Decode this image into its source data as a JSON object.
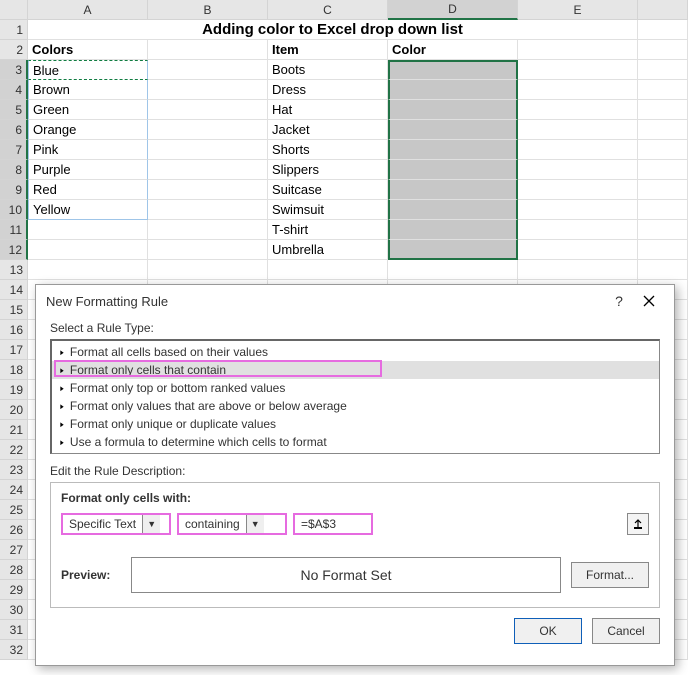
{
  "columns": [
    "A",
    "B",
    "C",
    "D",
    "E"
  ],
  "rows_shown": 32,
  "title": "Adding color to Excel drop down list",
  "headers": {
    "a": "Colors",
    "c": "Item",
    "d": "Color"
  },
  "colA": [
    "Blue",
    "Brown",
    "Green",
    "Orange",
    "Pink",
    "Purple",
    "Red",
    "Yellow"
  ],
  "colC": [
    "Boots",
    "Dress",
    "Hat",
    "Jacket",
    "Shorts",
    "Slippers",
    "Suitcase",
    "Swimsuit",
    "T-shirt",
    "Umbrella"
  ],
  "dialog": {
    "title": "New Formatting Rule",
    "select_label": "Select a Rule Type:",
    "rules": [
      "Format all cells based on their values",
      "Format only cells that contain",
      "Format only top or bottom ranked values",
      "Format only values that are above or below average",
      "Format only unique or duplicate values",
      "Use a formula to determine which cells to format"
    ],
    "selected_rule_index": 1,
    "edit_label": "Edit the Rule Description:",
    "format_with": "Format only cells with:",
    "combo1": "Specific Text",
    "combo2": "containing",
    "formula": "=$A$3",
    "preview_label": "Preview:",
    "preview_text": "No Format Set",
    "format_btn": "Format...",
    "ok": "OK",
    "cancel": "Cancel"
  },
  "chart_data": {
    "type": "table",
    "columns": [
      "Colors",
      "Item",
      "Color"
    ],
    "rows": [
      [
        "Blue",
        "Boots",
        ""
      ],
      [
        "Brown",
        "Dress",
        ""
      ],
      [
        "Green",
        "Hat",
        ""
      ],
      [
        "Orange",
        "Jacket",
        ""
      ],
      [
        "Pink",
        "Shorts",
        ""
      ],
      [
        "Purple",
        "Slippers",
        ""
      ],
      [
        "Red",
        "Suitcase",
        ""
      ],
      [
        "Yellow",
        "Swimsuit",
        ""
      ],
      [
        "",
        "T-shirt",
        ""
      ],
      [
        "",
        "Umbrella",
        ""
      ]
    ]
  }
}
